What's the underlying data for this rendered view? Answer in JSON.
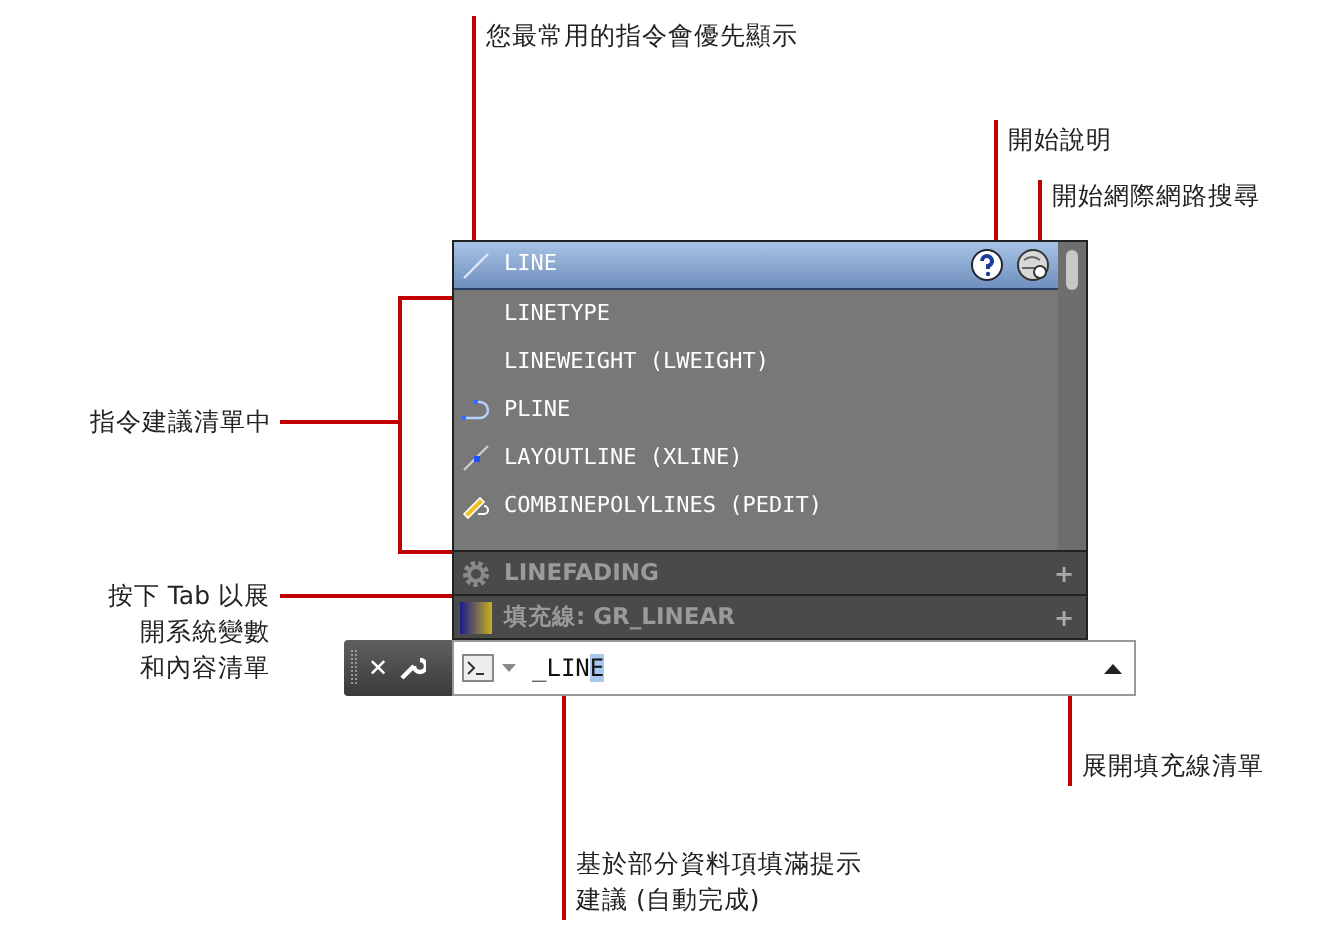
{
  "suggestions": [
    {
      "label": "LINE",
      "kind": "line",
      "selected": true
    },
    {
      "label": "LINETYPE",
      "kind": "plain",
      "selected": false
    },
    {
      "label": "LINEWEIGHT (LWEIGHT)",
      "kind": "plain",
      "selected": false
    },
    {
      "label": "PLINE",
      "kind": "pline",
      "selected": false
    },
    {
      "label": "LAYOUTLINE (XLINE)",
      "kind": "xline",
      "selected": false
    },
    {
      "label": "COMBINEPOLYLINES (PEDIT)",
      "kind": "pedit",
      "selected": false
    }
  ],
  "categories": [
    {
      "label": "LINEFADING",
      "kind": "variable",
      "expand": "+"
    },
    {
      "label": "填充線: GR_LINEAR",
      "kind": "hatch",
      "expand": "+"
    }
  ],
  "command_line": {
    "close": "✕",
    "typed": "_LIN",
    "completion": "E"
  },
  "callouts": [
    {
      "kind": "top",
      "text": [
        "您最常用的指令會優先顯示"
      ]
    },
    {
      "kind": "help",
      "text": [
        "開始說明"
      ]
    },
    {
      "kind": "web",
      "text": [
        "開始網際網路搜尋"
      ]
    },
    {
      "kind": "list",
      "text": [
        "指令建議清單中"
      ]
    },
    {
      "kind": "tab",
      "text": [
        "按下 Tab 以展",
        "開系統變數",
        "和內容清單"
      ]
    },
    {
      "kind": "expand",
      "text": [
        "展開填充線清單"
      ]
    },
    {
      "kind": "auto",
      "text": [
        "基於部分資料項填滿提示",
        "建議 (自動完成)"
      ]
    }
  ]
}
